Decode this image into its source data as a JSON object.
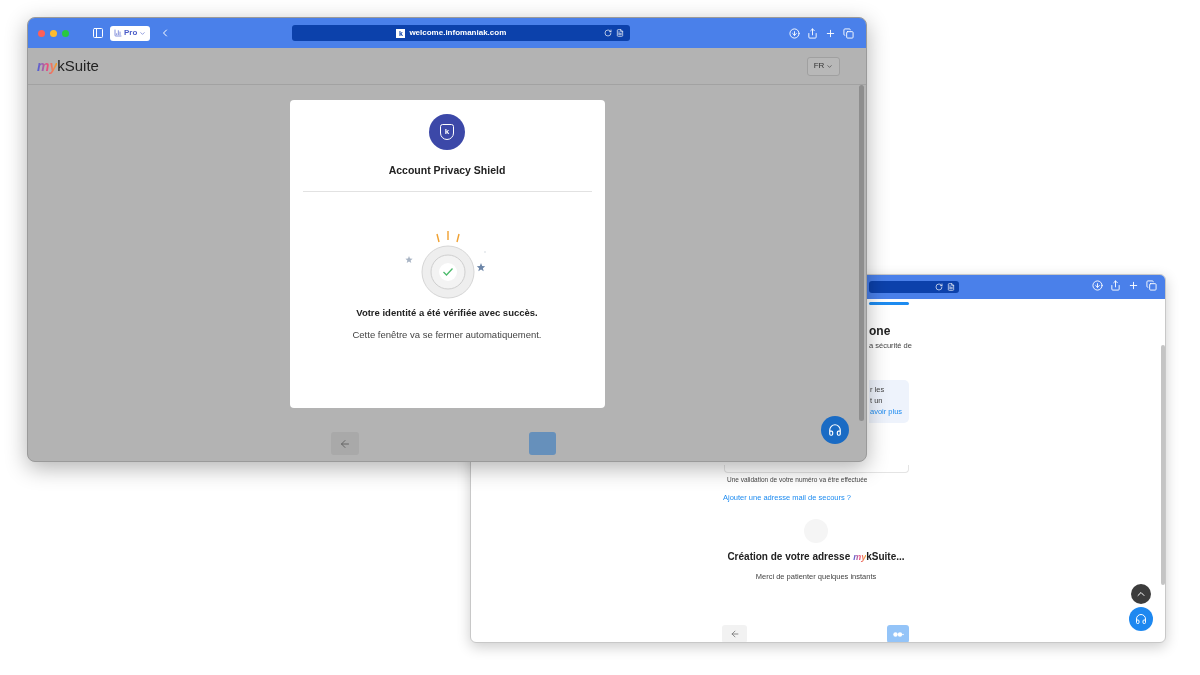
{
  "front_window": {
    "profile": "Pro",
    "favicon": "k",
    "url": "welcome.infomaniak.com",
    "logo": {
      "prefix": "my",
      "name": "kSuite"
    },
    "language": "FR",
    "dialog": {
      "badge": "k",
      "title": "Account Privacy Shield",
      "message": "Votre identité a été vérifiée avec succès.",
      "note": "Cette fenêtre va se fermer automatiquement."
    }
  },
  "back_window": {
    "heading": "one",
    "subtitle": "a sécurité de",
    "info_lines": [
      "r les",
      "t un"
    ],
    "info_link": "avoir plus",
    "phone_hint": "Une validation de votre numéro va être effectuée",
    "backup_link": "Ajouter une adresse mail de secours ?",
    "creation": {
      "before": "Création de votre adresse",
      "logo_prefix": "my",
      "after": "kSuite..."
    },
    "wait": "Merci de patienter quelques instants"
  }
}
